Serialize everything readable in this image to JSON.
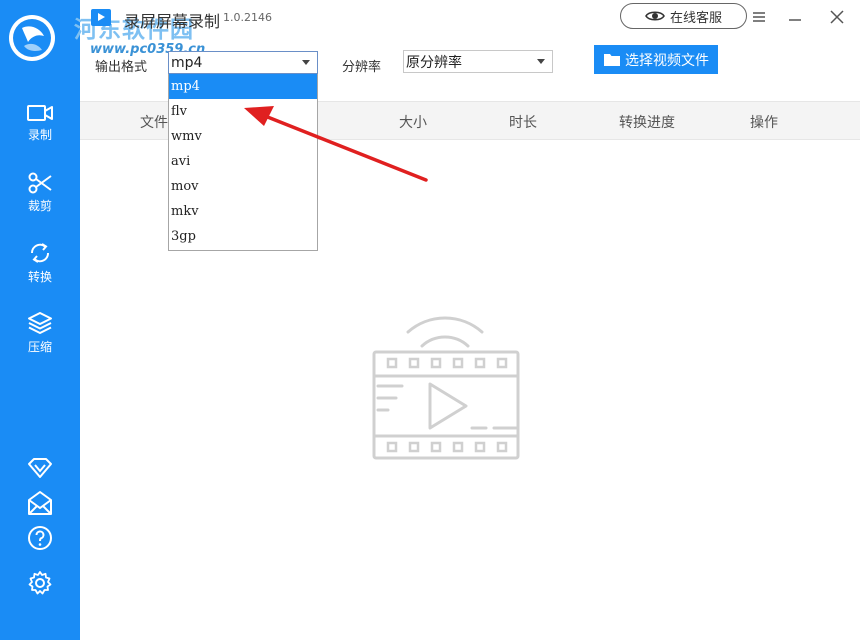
{
  "watermark": {
    "text": "河东软件园",
    "url": "www.pc0359.cn"
  },
  "title_bar": {
    "title": "录屏屏幕录制",
    "version": "1.0.2146",
    "service_label": "在线客服"
  },
  "sidebar": {
    "items": [
      {
        "label": "录制",
        "icon": "video-camera-icon"
      },
      {
        "label": "裁剪",
        "icon": "scissors-icon"
      },
      {
        "label": "转换",
        "icon": "convert-icon"
      },
      {
        "label": "压缩",
        "icon": "layers-icon"
      }
    ],
    "bottom_icons": [
      "vip-diamond-icon",
      "mail-icon",
      "help-icon",
      "settings-icon"
    ]
  },
  "toolbar": {
    "format_label": "输出格式",
    "format_value": "mp4",
    "resolution_label": "分辨率",
    "resolution_value": "原分辨率",
    "choose_file_label": "选择视频文件"
  },
  "table": {
    "headers": [
      "文件",
      "大小",
      "时长",
      "转换进度",
      "操作"
    ]
  },
  "format_dropdown": {
    "options": [
      "mp4",
      "flv",
      "wmv",
      "avi",
      "mov",
      "mkv",
      "3gp"
    ],
    "selected": "mp4"
  },
  "colors": {
    "accent": "#1a8cf5",
    "annotation": "#e02020"
  }
}
